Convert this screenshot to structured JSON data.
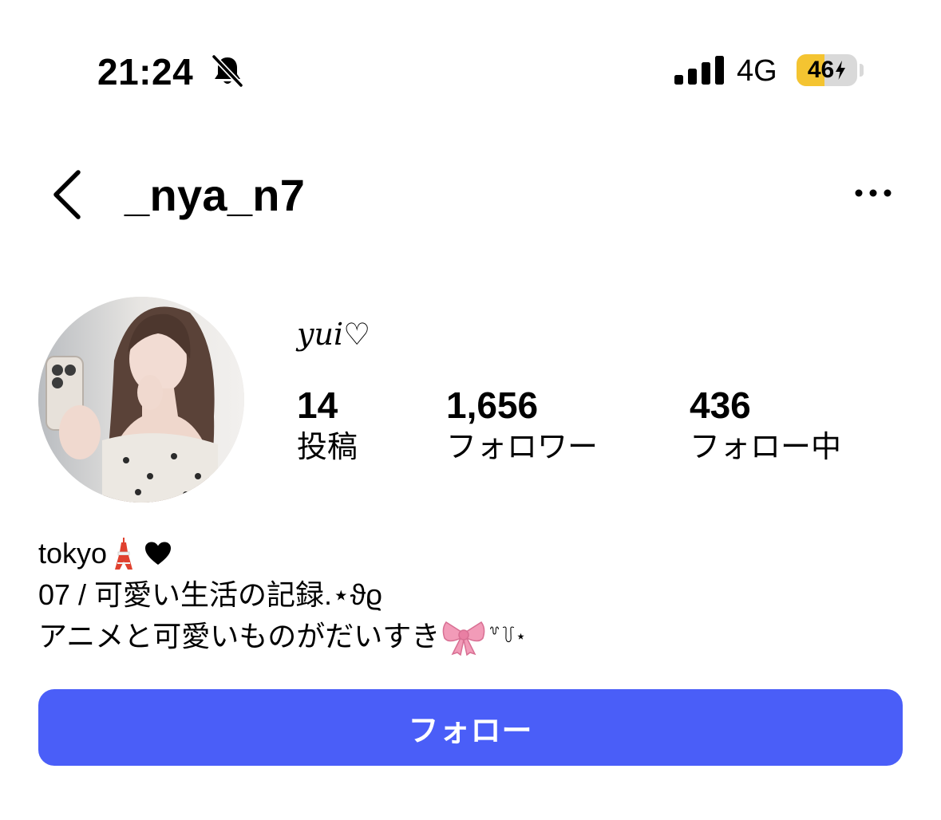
{
  "status_bar": {
    "time": "21:24",
    "network": "4G",
    "battery_level": "46",
    "battery_fraction": 0.46,
    "icons": [
      "bell-slash-icon",
      "cellular-signal-icon",
      "battery-charging-icon"
    ]
  },
  "header": {
    "username": "_nya_n7",
    "icons": [
      "back-chevron-icon",
      "more-options-icon"
    ]
  },
  "profile": {
    "display_name": "yui♡",
    "stats": [
      {
        "value": "14",
        "label": "投稿"
      },
      {
        "value": "1,656",
        "label": "フォロワー"
      },
      {
        "value": "436",
        "label": "フォロー中"
      }
    ]
  },
  "bio": {
    "line1": "tokyo",
    "line2": "07 / 可愛い生活の記録.⋆ϑϱ",
    "line3_text": "アニメと可愛いものがだいすき",
    "line3_suffix": "꒷꒦⋆",
    "icons": [
      "tokyo-tower-icon",
      "black-heart-icon",
      "pink-ribbon-icon"
    ]
  },
  "actions": {
    "follow_label": "フォロー"
  },
  "colors": {
    "follow_button": "#4a5ef8",
    "battery_fill": "#f4c431",
    "ribbon": "#f29bb8",
    "tower": "#e0412f"
  }
}
